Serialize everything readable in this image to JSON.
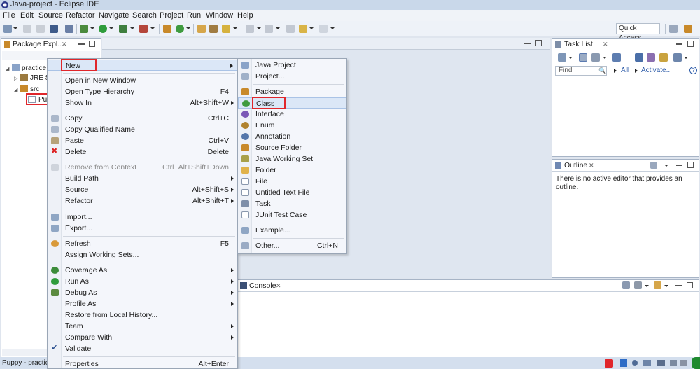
{
  "window": {
    "title": "Java-project - Eclipse IDE"
  },
  "menubar": [
    "File",
    "Edit",
    "Source",
    "Refactor",
    "Navigate",
    "Search",
    "Project",
    "Run",
    "Window",
    "Help"
  ],
  "toolbar": {
    "quick_access": "Quick Access"
  },
  "package_explorer": {
    "title": "Package Expl...",
    "tree": {
      "project": "practice",
      "jre": "JRE Sy",
      "src": "src",
      "selected": "Pup"
    }
  },
  "status": {
    "left": "Puppy - practice"
  },
  "task_list": {
    "title": "Task List",
    "find_placeholder": "Find",
    "all": "All",
    "activate": "Activate..."
  },
  "outline": {
    "title": "Outline",
    "message": "There is no active editor that provides an outline."
  },
  "console": {
    "title": "Console"
  },
  "context_menu": {
    "items": [
      {
        "label": "New",
        "shortcut": "",
        "submenu": true
      },
      {
        "label": "Open in New Window",
        "shortcut": ""
      },
      {
        "label": "Open Type Hierarchy",
        "shortcut": "F4"
      },
      {
        "label": "Show In",
        "shortcut": "Alt+Shift+W",
        "submenu": true
      },
      {
        "label": "Copy",
        "shortcut": "Ctrl+C"
      },
      {
        "label": "Copy Qualified Name",
        "shortcut": ""
      },
      {
        "label": "Paste",
        "shortcut": "Ctrl+V"
      },
      {
        "label": "Delete",
        "shortcut": "Delete"
      },
      {
        "label": "Remove from Context",
        "shortcut": "Ctrl+Alt+Shift+Down",
        "disabled": true
      },
      {
        "label": "Build Path",
        "shortcut": "",
        "submenu": true
      },
      {
        "label": "Source",
        "shortcut": "Alt+Shift+S",
        "submenu": true
      },
      {
        "label": "Refactor",
        "shortcut": "Alt+Shift+T",
        "submenu": true
      },
      {
        "label": "Import...",
        "shortcut": ""
      },
      {
        "label": "Export...",
        "shortcut": ""
      },
      {
        "label": "Refresh",
        "shortcut": "F5"
      },
      {
        "label": "Assign Working Sets...",
        "shortcut": ""
      },
      {
        "label": "Coverage As",
        "shortcut": "",
        "submenu": true
      },
      {
        "label": "Run As",
        "shortcut": "",
        "submenu": true
      },
      {
        "label": "Debug As",
        "shortcut": "",
        "submenu": true
      },
      {
        "label": "Profile As",
        "shortcut": "",
        "submenu": true
      },
      {
        "label": "Restore from Local History...",
        "shortcut": ""
      },
      {
        "label": "Team",
        "shortcut": "",
        "submenu": true
      },
      {
        "label": "Compare With",
        "shortcut": "",
        "submenu": true
      },
      {
        "label": "Validate",
        "shortcut": ""
      },
      {
        "label": "Properties",
        "shortcut": "Alt+Enter"
      }
    ]
  },
  "new_submenu": {
    "items": [
      {
        "label": "Java Project",
        "shortcut": ""
      },
      {
        "label": "Project...",
        "shortcut": ""
      },
      {
        "label": "Package",
        "shortcut": ""
      },
      {
        "label": "Class",
        "shortcut": ""
      },
      {
        "label": "Interface",
        "shortcut": ""
      },
      {
        "label": "Enum",
        "shortcut": ""
      },
      {
        "label": "Annotation",
        "shortcut": ""
      },
      {
        "label": "Source Folder",
        "shortcut": ""
      },
      {
        "label": "Java Working Set",
        "shortcut": ""
      },
      {
        "label": "Folder",
        "shortcut": ""
      },
      {
        "label": "File",
        "shortcut": ""
      },
      {
        "label": "Untitled Text File",
        "shortcut": ""
      },
      {
        "label": "Task",
        "shortcut": ""
      },
      {
        "label": "JUnit Test Case",
        "shortcut": ""
      },
      {
        "label": "Example...",
        "shortcut": ""
      },
      {
        "label": "Other...",
        "shortcut": "Ctrl+N"
      }
    ]
  },
  "colors": {
    "highlight_box": "#e0262b",
    "class_icon": "#3f9b3f",
    "package_icon": "#c8892a"
  }
}
